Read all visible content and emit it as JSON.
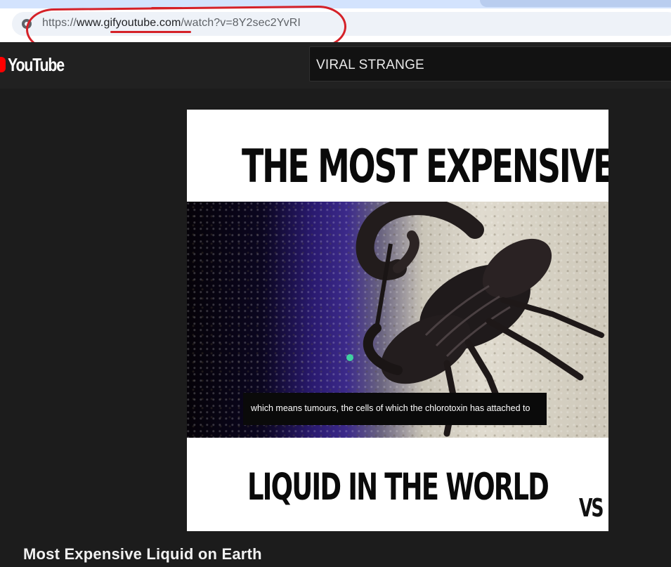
{
  "browser": {
    "url_scheme": "https://",
    "url_www": "www.",
    "url_domain": "gifyoutube.com",
    "url_path": "/watch?v=8Y2sec2YvRI",
    "annotation_color": "#d52128"
  },
  "youtube": {
    "logo_text": "YouTube",
    "channel_name": "VIRAL STRANGE",
    "logo_color": "#ff0000"
  },
  "video": {
    "headline_top": "THE MOST EXPENSIVE",
    "headline_bottom": "LIQUID IN THE WORLD",
    "caption": "which means tumours, the cells of which the chlorotoxin has attached to",
    "badge": "VS",
    "title": "Most Expensive Liquid on Earth"
  }
}
